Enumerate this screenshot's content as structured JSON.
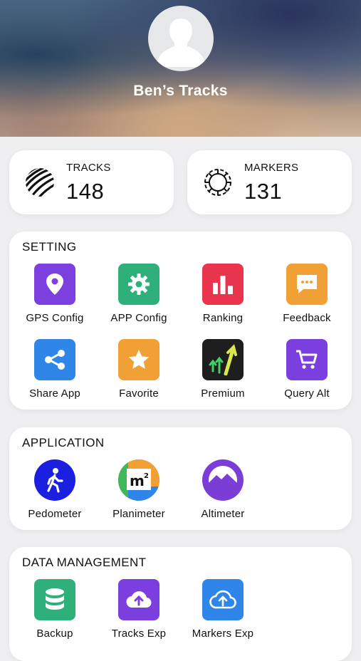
{
  "profile": {
    "name": "Ben’s Tracks"
  },
  "stats": [
    {
      "label": "TRACKS",
      "value": "148",
      "icon": "tracks-icon"
    },
    {
      "label": "MARKERS",
      "value": "131",
      "icon": "markers-icon"
    }
  ],
  "setting": {
    "title": "SETTING",
    "items": [
      {
        "label": "GPS Config",
        "icon": "location-pin-icon",
        "color": "#7c3fe0"
      },
      {
        "label": "APP Config",
        "icon": "gear-icon",
        "color": "#2fb07a"
      },
      {
        "label": "Ranking",
        "icon": "bar-chart-icon",
        "color": "#e8344c"
      },
      {
        "label": "Feedback",
        "icon": "chat-bubble-icon",
        "color": "#f0a035"
      },
      {
        "label": "Share App",
        "icon": "share-icon",
        "color": "#2f86e8"
      },
      {
        "label": "Favorite",
        "icon": "star-icon",
        "color": "#f0a035"
      },
      {
        "label": "Premium",
        "icon": "growth-arrows-icon",
        "color": "#1e1e1e"
      },
      {
        "label": "Query Alt",
        "icon": "cart-icon",
        "color": "#7b3fe0"
      }
    ]
  },
  "application": {
    "title": "APPLICATION",
    "items": [
      {
        "label": "Pedometer",
        "icon": "walking-person-icon",
        "color": "#1a1fe0"
      },
      {
        "label": "Planimeter",
        "icon": "square-meter-icon",
        "color": "#f0a035"
      },
      {
        "label": "Altimeter",
        "icon": "mountain-icon",
        "color": "#7a3ed6"
      }
    ]
  },
  "data_management": {
    "title": "DATA MANAGEMENT",
    "items": [
      {
        "label": "Backup",
        "icon": "database-icon",
        "color": "#2fb07a"
      },
      {
        "label": "Tracks Exp",
        "icon": "cloud-upload-icon",
        "color": "#7b3fe0"
      },
      {
        "label": "Markers Exp",
        "icon": "cloud-upload-outline-icon",
        "color": "#2f86e8"
      }
    ]
  }
}
